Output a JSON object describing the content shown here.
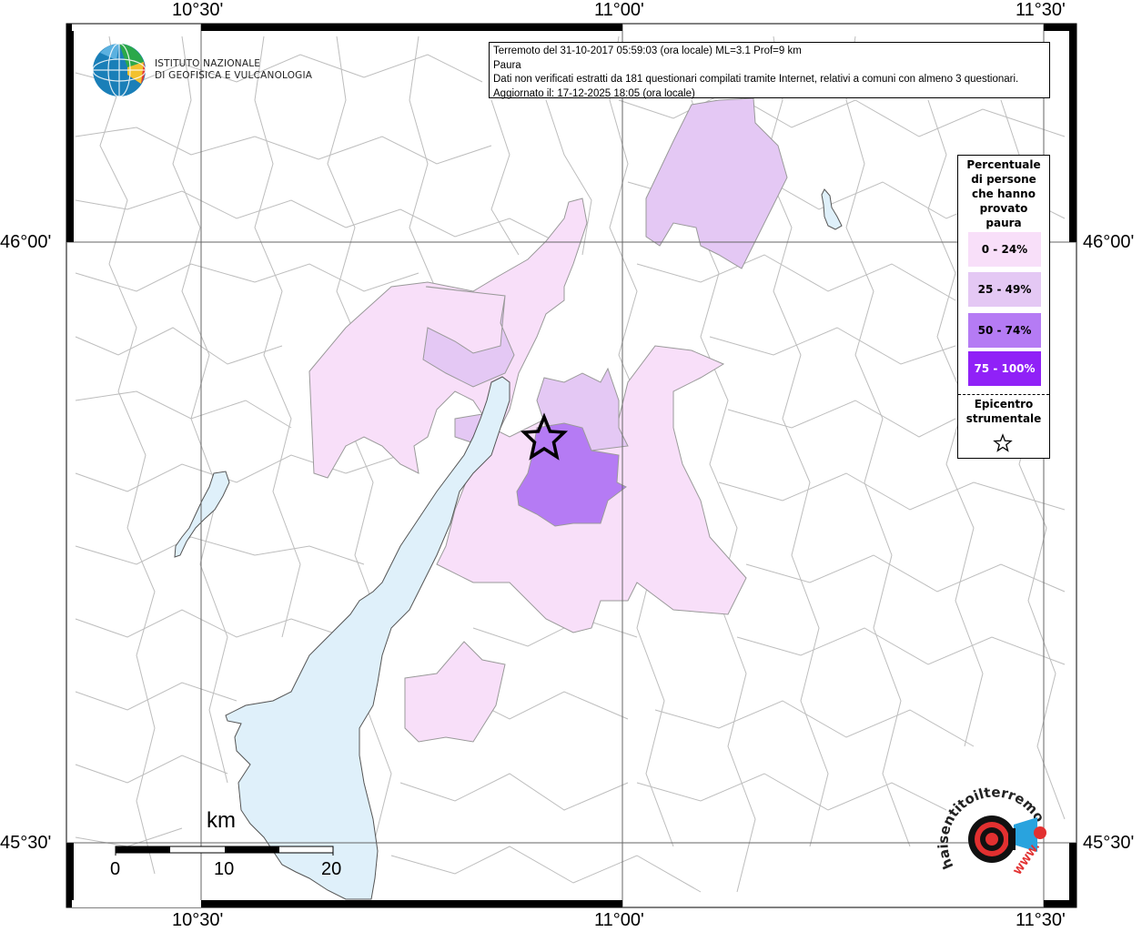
{
  "info": {
    "line1": "Terremoto del 31-10-2017 05:59:03 (ora locale) ML=3.1 Prof=9 km",
    "line2": "Paura",
    "line3": "Dati non verificati estratti da 181 questionari compilati tramite Internet, relativi a comuni con almeno 3 questionari.",
    "line4": "Aggiornato il: 17-12-2025 18:05 (ora locale)"
  },
  "axes": {
    "top": [
      "10°30'",
      "11°00'",
      "11°30'"
    ],
    "bottom": [
      "10°30'",
      "11°00'",
      "11°30'"
    ],
    "left": [
      "46°00'",
      "45°30'"
    ],
    "right": [
      "46°00'",
      "45°30'"
    ]
  },
  "legend": {
    "title_lines": [
      "Percentuale",
      "di persone",
      "che hanno",
      "provato",
      "paura"
    ],
    "classes": [
      {
        "label": "0 - 24%",
        "color": "#f8dff9",
        "text_color": "#000000"
      },
      {
        "label": "25 - 49%",
        "color": "#e4c8f4",
        "text_color": "#000000"
      },
      {
        "label": "50 - 74%",
        "color": "#b57bf4",
        "text_color": "#000000"
      },
      {
        "label": "75 - 100%",
        "color": "#9021f7",
        "text_color": "#ffffff"
      }
    ],
    "epicenter_lines": [
      "Epicentro",
      "strumentale"
    ]
  },
  "logos": {
    "ingv_lines": [
      "ISTITUTO NAZIONALE",
      "DI GEOFISICA E VULCANOLOGIA"
    ],
    "hsit_text": "haisentitoilterremoto.it",
    "hsit_www": "WWW."
  },
  "scale": {
    "unit": "km",
    "labels": [
      "0",
      "10",
      "20"
    ]
  },
  "colors": {
    "lake": "#dff0fa",
    "borders": "#b8b8b8",
    "grid": "#666666"
  }
}
